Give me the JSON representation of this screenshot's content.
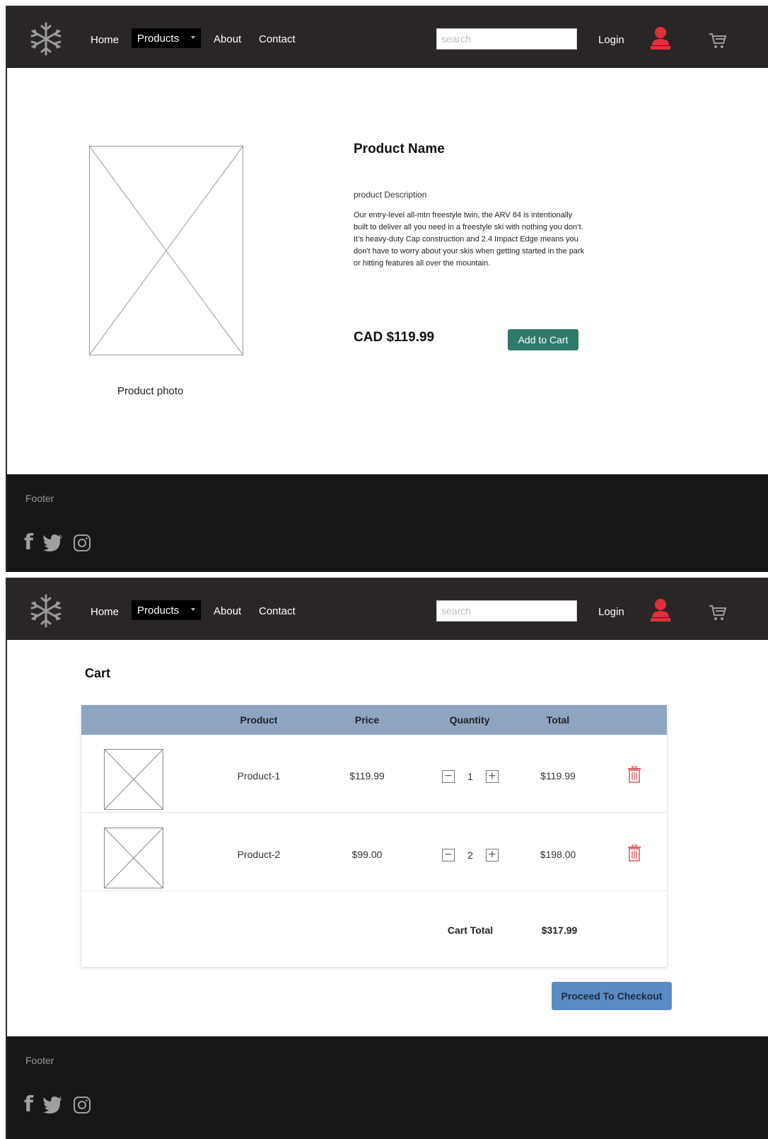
{
  "nav": {
    "home": "Home",
    "products": "Products",
    "about": "About",
    "contact": "Contact",
    "search_placeholder": "search",
    "login": "Login",
    "icons": [
      "snowflake-logo-icon",
      "user-icon",
      "cart-icon"
    ],
    "accent_color": "#e0303a"
  },
  "product_page": {
    "photo_caption": "Product photo",
    "name": "Product Name",
    "description_label": "product Description",
    "description": "Our entry-level all-mtn freestyle twin, the ARV 84 is intentionally built to deliver all you need in a freestyle ski with nothing you don’t. It’s heavy-duty Cap construction and 2.4 Impact Edge means you don't have to worry about your skis when getting started in the park or hitting features all over the mountain.",
    "price": "CAD $119.99",
    "add_to_cart": "Add to Cart",
    "button_color": "#2f7a6a"
  },
  "cart_page": {
    "title": "Cart",
    "columns": [
      "Product",
      "Price",
      "Quantity",
      "Total"
    ],
    "items": [
      {
        "name": "Product-1",
        "price": "$119.99",
        "quantity": "1",
        "total": "$119.99"
      },
      {
        "name": "Product-2",
        "price": "$99.00",
        "quantity": "2",
        "total": "$198.00"
      }
    ],
    "cart_total_label": "Cart Total",
    "cart_total_value": "$317.99",
    "checkout_button": "Proceed To Checkout",
    "header_color": "#8ea5c2",
    "checkout_color": "#5b8bc4"
  },
  "footer": {
    "label": "Footer",
    "social_icons": [
      "facebook-icon",
      "twitter-icon",
      "instagram-icon"
    ]
  }
}
